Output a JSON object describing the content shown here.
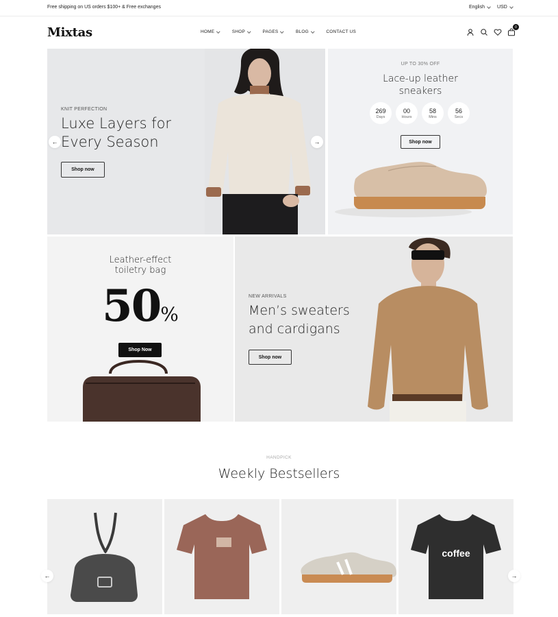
{
  "topbar": {
    "promo": "Free shipping on US orders $100+ & Free exchanges",
    "language": "English",
    "currency": "USD"
  },
  "header": {
    "logo": "Mixtas",
    "nav": [
      {
        "label": "HOME",
        "dropdown": true
      },
      {
        "label": "SHOP",
        "dropdown": true
      },
      {
        "label": "PAGES",
        "dropdown": true
      },
      {
        "label": "BLOG",
        "dropdown": true
      },
      {
        "label": "CONTACT US",
        "dropdown": false
      }
    ],
    "icons": [
      "user-icon",
      "search-icon",
      "heart-icon",
      "cart-icon"
    ],
    "cart_count": "0"
  },
  "hero": {
    "eyebrow": "KNIT PERFECTION",
    "title_line1": "Luxe Layers for",
    "title_line2": "Every Season",
    "cta": "Shop now"
  },
  "promo_sneakers": {
    "eyebrow": "UP TO 30% OFF",
    "title_line1": "Lace-up leather",
    "title_line2": "sneakers",
    "countdown": [
      {
        "value": "269",
        "unit": "Days"
      },
      {
        "value": "00",
        "unit": "Hours"
      },
      {
        "value": "58",
        "unit": "Mins"
      },
      {
        "value": "56",
        "unit": "Secs"
      }
    ],
    "cta": "Shop now"
  },
  "promo_bag": {
    "title_line1": "Leather-effect",
    "title_line2": "toiletry bag",
    "discount_number": "50",
    "discount_symbol": "%",
    "cta": "Shop Now"
  },
  "promo_men": {
    "eyebrow": "NEW ARRIVALS",
    "title_line1": "Men’s sweaters",
    "title_line2": "and cardigans",
    "cta": "Shop now"
  },
  "bestsellers": {
    "eyebrow": "HANDPICK",
    "title": "Weekly Bestsellers",
    "products": [
      {
        "image": "shoulder-bag-image"
      },
      {
        "image": "brown-tshirt-image"
      },
      {
        "image": "sneaker-image"
      },
      {
        "image": "black-coffee-tshirt-image",
        "print_text": "coffee"
      }
    ]
  }
}
